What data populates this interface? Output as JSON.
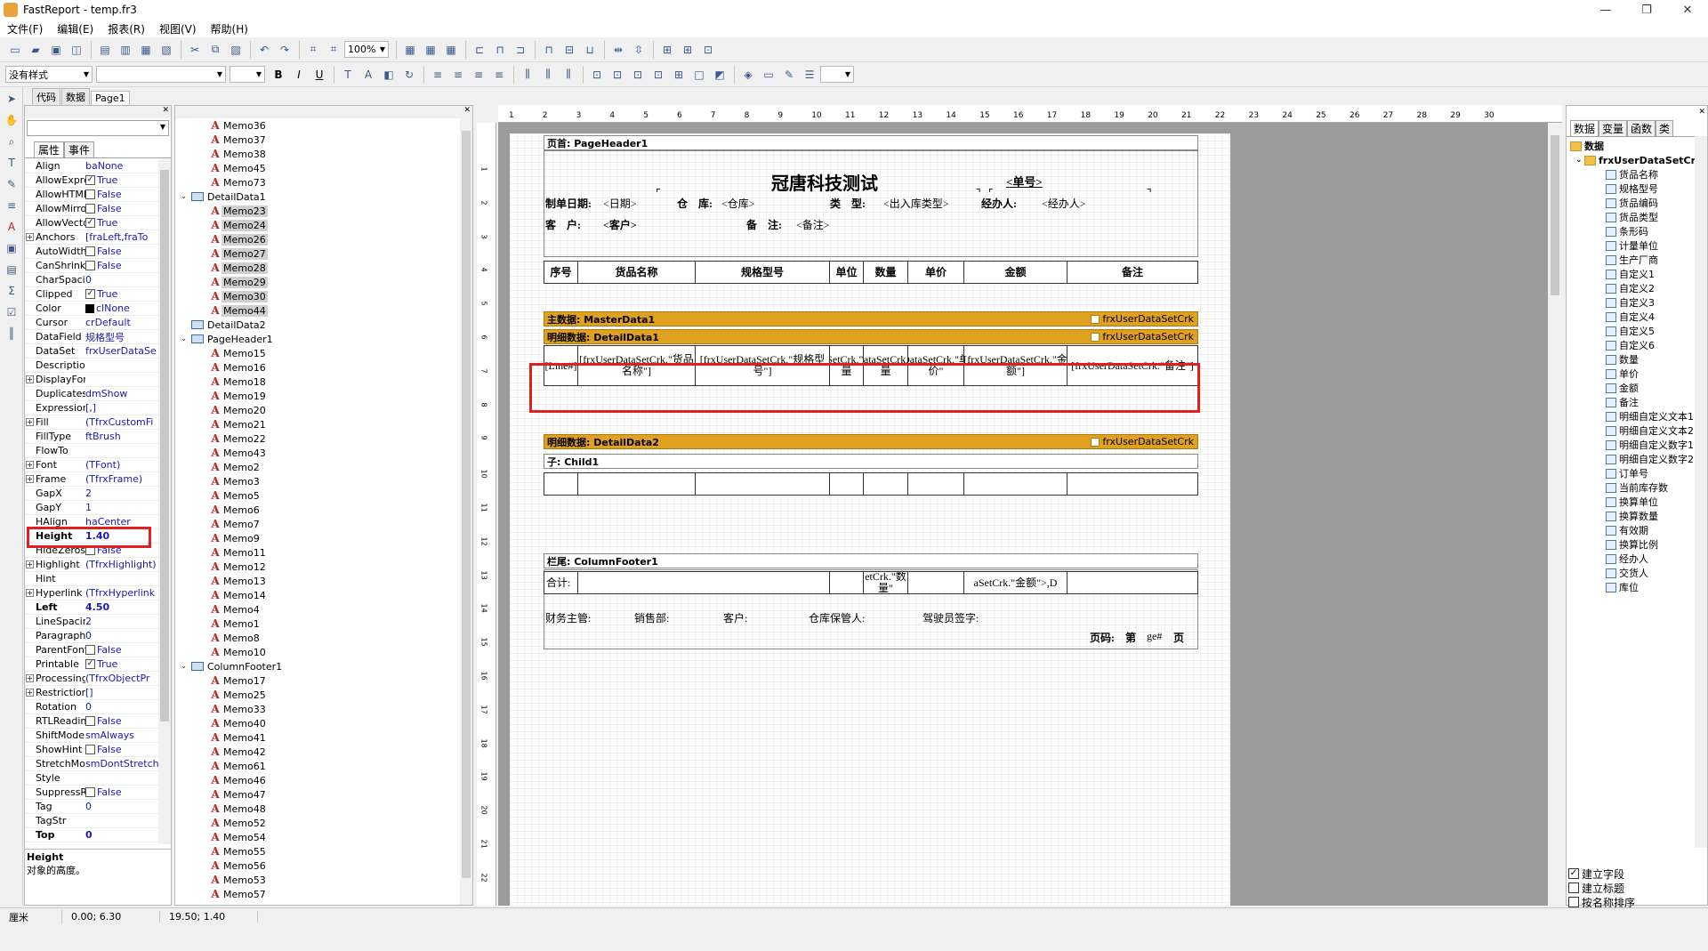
{
  "window": {
    "title": "FastReport - temp.fr3",
    "minimize": "—",
    "restore": "❐",
    "close": "✕"
  },
  "menu": [
    "文件(F)",
    "编辑(E)",
    "报表(R)",
    "视图(V)",
    "帮助(H)"
  ],
  "toolbar1": {
    "zoom": "100%"
  },
  "toolbar2": {
    "style": "没有样式",
    "font": "",
    "size": "",
    "bold": "B",
    "italic": "I",
    "underline": "U"
  },
  "tabs": [
    "代码",
    "数据",
    "Page1"
  ],
  "inspector": {
    "tabs": [
      "属性",
      "事件"
    ],
    "props": [
      {
        "n": "Align",
        "v": "baNone"
      },
      {
        "n": "AllowExpress",
        "v": "True",
        "cb": "✓"
      },
      {
        "n": "AllowHTMLTa",
        "v": "False",
        "cb": ""
      },
      {
        "n": "AllowMirrorM",
        "v": "False",
        "cb": ""
      },
      {
        "n": "AllowVectorE",
        "v": "True",
        "cb": "✓"
      },
      {
        "n": "Anchors",
        "v": "[fraLeft,fraTo",
        "ex": "+"
      },
      {
        "n": "AutoWidth",
        "v": "False",
        "cb": ""
      },
      {
        "n": "CanShrink",
        "v": "False",
        "cb": ""
      },
      {
        "n": "CharSpacing",
        "v": "0"
      },
      {
        "n": "Clipped",
        "v": "True",
        "cb": "✓"
      },
      {
        "n": "Color",
        "v": "clNone",
        "sw": "1"
      },
      {
        "n": "Cursor",
        "v": "crDefault"
      },
      {
        "n": "DataField",
        "v": "规格型号"
      },
      {
        "n": "DataSet",
        "v": "frxUserDataSe"
      },
      {
        "n": "Description",
        "v": ""
      },
      {
        "n": "DisplayForma",
        "v": "",
        "ex": "+"
      },
      {
        "n": "Duplicates",
        "v": "dmShow"
      },
      {
        "n": "ExpressionDe",
        "v": "[,]"
      },
      {
        "n": "Fill",
        "v": "(TfrxCustomFi",
        "ex": "+"
      },
      {
        "n": "FillType",
        "v": "ftBrush"
      },
      {
        "n": "FlowTo",
        "v": ""
      },
      {
        "n": "Font",
        "v": "(TFont)",
        "ex": "+"
      },
      {
        "n": "Frame",
        "v": "(TfrxFrame)",
        "ex": "+"
      },
      {
        "n": "GapX",
        "v": "2"
      },
      {
        "n": "GapY",
        "v": "1"
      },
      {
        "n": "HAlign",
        "v": "haCenter"
      },
      {
        "n": "Height",
        "v": "1.40",
        "b": "1"
      },
      {
        "n": "HideZeros",
        "v": "False",
        "cb": ""
      },
      {
        "n": "Highlight",
        "v": "(TfrxHighlight)",
        "ex": "+"
      },
      {
        "n": "Hint",
        "v": ""
      },
      {
        "n": "Hyperlink",
        "v": "(TfrxHyperlink",
        "ex": "+"
      },
      {
        "n": "Left",
        "v": "4.50",
        "b": "1"
      },
      {
        "n": "LineSpacing",
        "v": "2"
      },
      {
        "n": "ParagraphGa",
        "v": "0"
      },
      {
        "n": "ParentFont",
        "v": "False",
        "cb": ""
      },
      {
        "n": "Printable",
        "v": "True",
        "cb": "✓"
      },
      {
        "n": "Processing",
        "v": "(TfrxObjectPr",
        "ex": "+"
      },
      {
        "n": "Restrictions",
        "v": "[]",
        "ex": "+"
      },
      {
        "n": "Rotation",
        "v": "0"
      },
      {
        "n": "RTLReading",
        "v": "False",
        "cb": ""
      },
      {
        "n": "ShiftMode",
        "v": "smAlways"
      },
      {
        "n": "ShowHint",
        "v": "False",
        "cb": ""
      },
      {
        "n": "StretchMode",
        "v": "smDontStretch"
      },
      {
        "n": "Style",
        "v": ""
      },
      {
        "n": "SuppressRep",
        "v": "False",
        "cb": ""
      },
      {
        "n": "Tag",
        "v": "0"
      },
      {
        "n": "TagStr",
        "v": ""
      },
      {
        "n": "Top",
        "v": "0",
        "b": "1"
      }
    ],
    "desc_title": "Height",
    "desc_text": "对象的高度。"
  },
  "tree": [
    {
      "k": "m",
      "t": "Memo36",
      "l": 2
    },
    {
      "k": "m",
      "t": "Memo37",
      "l": 2
    },
    {
      "k": "m",
      "t": "Memo38",
      "l": 2
    },
    {
      "k": "m",
      "t": "Memo45",
      "l": 2
    },
    {
      "k": "m",
      "t": "Memo73",
      "l": 2
    },
    {
      "k": "b",
      "t": "DetailData1",
      "l": 1,
      "g": "⌄"
    },
    {
      "k": "m",
      "t": "Memo23",
      "l": 2,
      "s": 1
    },
    {
      "k": "m",
      "t": "Memo24",
      "l": 2,
      "s": 1
    },
    {
      "k": "m",
      "t": "Memo26",
      "l": 2,
      "s": 1
    },
    {
      "k": "m",
      "t": "Memo27",
      "l": 2,
      "s": 1
    },
    {
      "k": "m",
      "t": "Memo28",
      "l": 2,
      "s": 1
    },
    {
      "k": "m",
      "t": "Memo29",
      "l": 2,
      "s": 1
    },
    {
      "k": "m",
      "t": "Memo30",
      "l": 2,
      "s": 1
    },
    {
      "k": "m",
      "t": "Memo44",
      "l": 2,
      "s": 1
    },
    {
      "k": "b",
      "t": "DetailData2",
      "l": 1
    },
    {
      "k": "b",
      "t": "PageHeader1",
      "l": 1,
      "g": "⌄"
    },
    {
      "k": "m",
      "t": "Memo15",
      "l": 2
    },
    {
      "k": "m",
      "t": "Memo16",
      "l": 2
    },
    {
      "k": "m",
      "t": "Memo18",
      "l": 2
    },
    {
      "k": "m",
      "t": "Memo19",
      "l": 2
    },
    {
      "k": "m",
      "t": "Memo20",
      "l": 2
    },
    {
      "k": "m",
      "t": "Memo21",
      "l": 2
    },
    {
      "k": "m",
      "t": "Memo22",
      "l": 2
    },
    {
      "k": "m",
      "t": "Memo43",
      "l": 2
    },
    {
      "k": "m",
      "t": "Memo2",
      "l": 2
    },
    {
      "k": "m",
      "t": "Memo3",
      "l": 2
    },
    {
      "k": "m",
      "t": "Memo5",
      "l": 2
    },
    {
      "k": "m",
      "t": "Memo6",
      "l": 2
    },
    {
      "k": "m",
      "t": "Memo7",
      "l": 2
    },
    {
      "k": "m",
      "t": "Memo9",
      "l": 2
    },
    {
      "k": "m",
      "t": "Memo11",
      "l": 2
    },
    {
      "k": "m",
      "t": "Memo12",
      "l": 2
    },
    {
      "k": "m",
      "t": "Memo13",
      "l": 2
    },
    {
      "k": "m",
      "t": "Memo14",
      "l": 2
    },
    {
      "k": "m",
      "t": "Memo4",
      "l": 2
    },
    {
      "k": "m",
      "t": "Memo1",
      "l": 2
    },
    {
      "k": "m",
      "t": "Memo8",
      "l": 2
    },
    {
      "k": "m",
      "t": "Memo10",
      "l": 2
    },
    {
      "k": "b",
      "t": "ColumnFooter1",
      "l": 1,
      "g": "⌄"
    },
    {
      "k": "m",
      "t": "Memo17",
      "l": 2
    },
    {
      "k": "m",
      "t": "Memo25",
      "l": 2
    },
    {
      "k": "m",
      "t": "Memo33",
      "l": 2
    },
    {
      "k": "m",
      "t": "Memo40",
      "l": 2
    },
    {
      "k": "m",
      "t": "Memo41",
      "l": 2
    },
    {
      "k": "m",
      "t": "Memo42",
      "l": 2
    },
    {
      "k": "m",
      "t": "Memo61",
      "l": 2
    },
    {
      "k": "m",
      "t": "Memo46",
      "l": 2
    },
    {
      "k": "m",
      "t": "Memo47",
      "l": 2
    },
    {
      "k": "m",
      "t": "Memo48",
      "l": 2
    },
    {
      "k": "m",
      "t": "Memo52",
      "l": 2
    },
    {
      "k": "m",
      "t": "Memo54",
      "l": 2
    },
    {
      "k": "m",
      "t": "Memo55",
      "l": 2
    },
    {
      "k": "m",
      "t": "Memo56",
      "l": 2
    },
    {
      "k": "m",
      "t": "Memo53",
      "l": 2
    },
    {
      "k": "m",
      "t": "Memo57",
      "l": 2
    }
  ],
  "ruler": [
    "1",
    "2",
    "3",
    "4",
    "5",
    "6",
    "7",
    "8",
    "9",
    "10",
    "11",
    "12",
    "13",
    "14",
    "15",
    "16",
    "17",
    "18",
    "19",
    "20",
    "21",
    "22",
    "23",
    "24",
    "25",
    "26",
    "27",
    "28",
    "29",
    "30"
  ],
  "vruler": [
    "1",
    "2",
    "3",
    "4",
    "5",
    "6",
    "7",
    "8",
    "9",
    "10",
    "11",
    "12",
    "13",
    "14",
    "15",
    "16",
    "17",
    "18",
    "19",
    "20",
    "21",
    "22"
  ],
  "report": {
    "pageheader": "页首: PageHeader1",
    "title": "冠唐科技测试",
    "billno": "<单号>",
    "date_label": "制单日期:",
    "date_val": "<日期>",
    "wh_label": "仓　库:",
    "wh_val": "<仓库>",
    "type_label": "类　型:",
    "type_val": "<出入库类型>",
    "handler_label": "经办人:",
    "handler_val": "<经办人>",
    "cust_label": "客　户:",
    "cust_val": "<客户>",
    "remark_label": "备　注:",
    "remark_val": "<备注>",
    "cols": [
      "序号",
      "货品名称",
      "规格型号",
      "单位",
      "数量",
      "单价",
      "金额",
      "备注"
    ],
    "master": "主数据: MasterData1",
    "dsname": "frxUserDataSetCrk",
    "detail1": "明细数据: DetailData1",
    "dcells": [
      "[Line#]",
      "[frxUserDataSetCrk.\"货品名称\"]",
      "[frxUserDataSetCrk.\"规格型号\"]",
      "taSetCrk.\"计量",
      "erDataSetCrk.\"数量",
      "DataSetCrk.\"单价\"",
      "[frxUserDataSetCrk.\"金额\"]",
      "[frxUserDataSetCrk.\"备注\"]"
    ],
    "detail2": "明细数据: DetailData2",
    "child": "子: Child1",
    "footer": "栏尾: ColumnFooter1",
    "sum_label": "合计:",
    "sum_qty": "etCrk.\"数量\"",
    "sum_amt": "aSetCrk.\"金额\">,D",
    "sign": [
      "财务主管:",
      "销售部:",
      "客户:",
      "仓库保管人:",
      "驾驶员签字:"
    ],
    "page_label": "页码:",
    "page_of": "第",
    "page_no": "ge#",
    "page_end": "页"
  },
  "rpanel": {
    "tabs": [
      "数据",
      "变量",
      "函数",
      "类"
    ],
    "root": "数据",
    "ds": "frxUserDataSetCrk",
    "fields": [
      "货品名称",
      "规格型号",
      "货品编码",
      "货品类型",
      "条形码",
      "计量单位",
      "生产厂商",
      "自定义1",
      "自定义2",
      "自定义3",
      "自定义4",
      "自定义5",
      "自定义6",
      "数量",
      "单价",
      "金额",
      "备注",
      "明细自定义文本1",
      "明细自定义文本2",
      "明细自定义数字1",
      "明细自定义数字2",
      "订单号",
      "当前库存数",
      "换算单位",
      "换算数量",
      "有效期",
      "换算比例",
      "经办人",
      "交货人",
      "库位"
    ],
    "checks": [
      {
        "t": "建立字段",
        "c": "✓"
      },
      {
        "t": "建立标题",
        "c": ""
      },
      {
        "t": "按名称排序",
        "c": ""
      }
    ]
  },
  "status": {
    "unit": "厘米",
    "pos": "0.00; 6.30",
    "size": "19.50; 1.40"
  }
}
